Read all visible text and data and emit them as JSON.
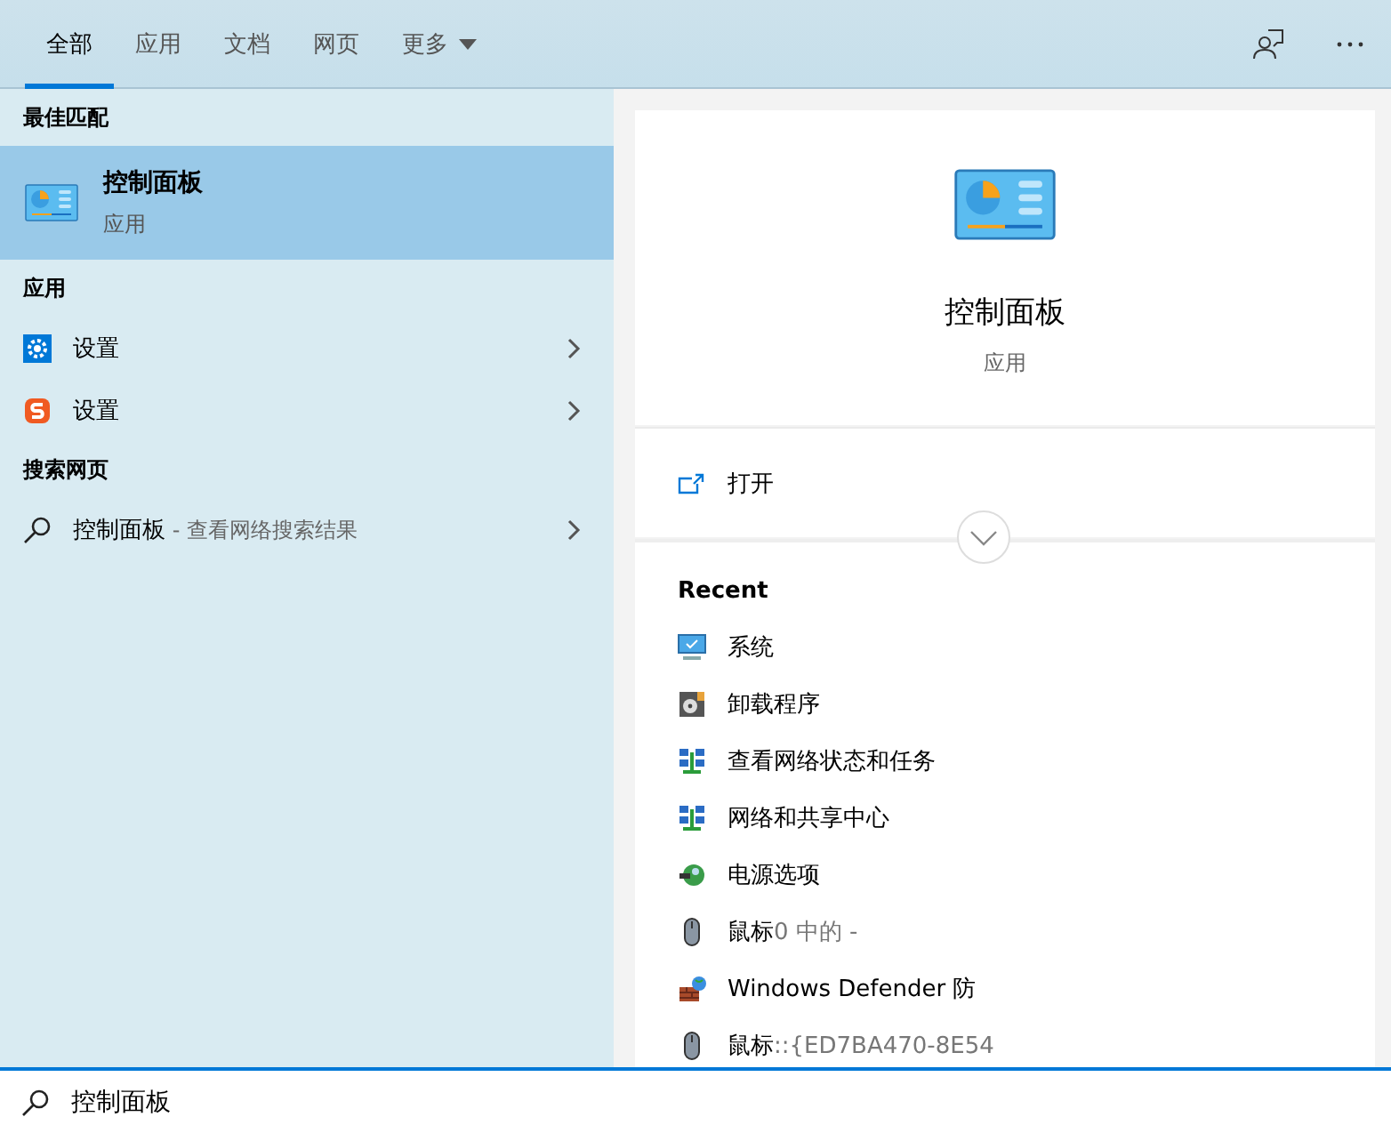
{
  "tabs": [
    {
      "label": "全部",
      "selected": true
    },
    {
      "label": "应用",
      "selected": false
    },
    {
      "label": "文档",
      "selected": false
    },
    {
      "label": "网页",
      "selected": false
    },
    {
      "label": "更多",
      "selected": false,
      "dropdown": true
    }
  ],
  "best_match": {
    "heading": "最佳匹配",
    "title": "控制面板",
    "subtitle": "应用",
    "selected": true
  },
  "apps": {
    "heading": "应用",
    "items": [
      {
        "label": "设置",
        "kind": "gear"
      },
      {
        "label": "设置",
        "kind": "sogou"
      }
    ]
  },
  "web": {
    "heading": "搜索网页",
    "items": [
      {
        "label": "控制面板",
        "detail": " - 查看网络搜索结果"
      }
    ]
  },
  "preview": {
    "title": "控制面板",
    "subtitle": "应用",
    "actions": [
      {
        "label": "打开"
      }
    ],
    "recent_heading": "Recent",
    "recent": [
      {
        "label": "系统",
        "kind": "monitor"
      },
      {
        "label": "卸载程序",
        "kind": "disk"
      },
      {
        "label": "查看网络状态和任务",
        "kind": "network"
      },
      {
        "label": "网络和共享中心",
        "kind": "network"
      },
      {
        "label": "电源选项",
        "kind": "power"
      },
      {
        "label": "鼠标",
        "detail": "0 中的 -",
        "kind": "mouse"
      },
      {
        "label": "Windows Defender 防",
        "kind": "firewall"
      },
      {
        "label": "鼠标",
        "detail": "::{ED7BA470-8E54",
        "kind": "mouse"
      }
    ]
  },
  "search": {
    "value": "控制面板"
  }
}
